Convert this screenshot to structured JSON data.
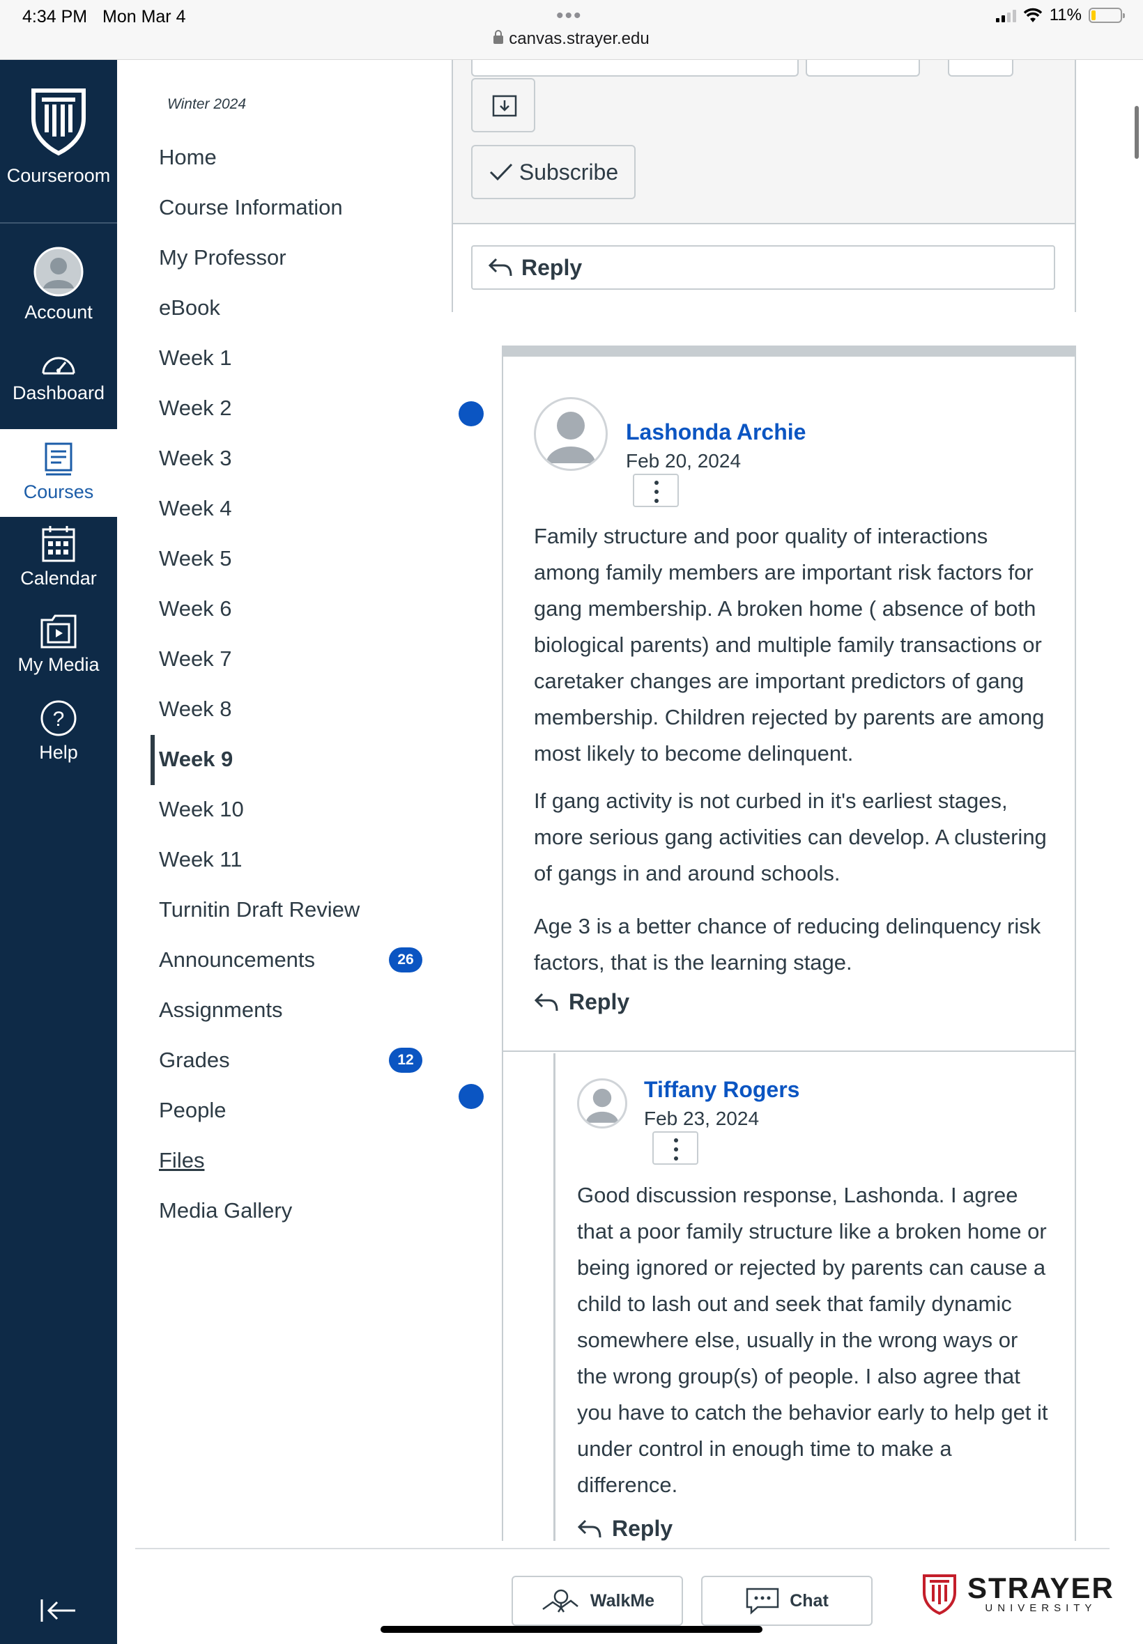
{
  "status_bar": {
    "time": "4:34 PM",
    "date": "Mon Mar 4",
    "url": "canvas.strayer.edu",
    "battery": "11%"
  },
  "global_nav": {
    "logo_label": "Courseroom",
    "items": [
      {
        "label": "Account",
        "icon": "account-icon"
      },
      {
        "label": "Dashboard",
        "icon": "dashboard-icon"
      },
      {
        "label": "Courses",
        "icon": "courses-icon"
      },
      {
        "label": "Calendar",
        "icon": "calendar-icon"
      },
      {
        "label": "My Media",
        "icon": "my-media-icon"
      },
      {
        "label": "Help",
        "icon": "help-icon"
      }
    ],
    "active": "Courses"
  },
  "course_nav": {
    "term": "Winter 2024",
    "items": [
      {
        "label": "Home"
      },
      {
        "label": "Course Information"
      },
      {
        "label": "My Professor"
      },
      {
        "label": "eBook"
      },
      {
        "label": "Week 1"
      },
      {
        "label": "Week 2"
      },
      {
        "label": "Week 3"
      },
      {
        "label": "Week 4"
      },
      {
        "label": "Week 5"
      },
      {
        "label": "Week 6"
      },
      {
        "label": "Week 7"
      },
      {
        "label": "Week 8"
      },
      {
        "label": "Week 9"
      },
      {
        "label": "Week 10"
      },
      {
        "label": "Week 11"
      },
      {
        "label": "Turnitin Draft Review"
      },
      {
        "label": "Announcements",
        "badge": "26"
      },
      {
        "label": "Assignments"
      },
      {
        "label": "Grades",
        "badge": "12"
      },
      {
        "label": "People"
      },
      {
        "label": "Files"
      },
      {
        "label": "Media Gallery"
      }
    ],
    "active": "Week 9"
  },
  "toolbar": {
    "subscribe_label": "Subscribe",
    "reply_label": "Reply"
  },
  "entries": [
    {
      "author": "Lashonda Archie",
      "date": "Feb 20, 2024",
      "paragraphs": [
        "Family structure and poor quality of interactions among family members are important risk factors for gang membership. A broken home ( absence of both biological parents) and multiple family transactions or caretaker changes are important predictors of gang membership. Children rejected by parents are among most likely to become delinquent.",
        "If gang activity is not curbed in it's earliest stages, more serious gang activities can develop. A clustering of gangs in and around schools.",
        "Age 3 is a better chance of reducing delinquency risk factors, that is the learning stage."
      ],
      "reply_label": "Reply"
    },
    {
      "author": "Tiffany Rogers",
      "date": "Feb 23, 2024",
      "paragraphs": [
        "Good discussion response, Lashonda. I agree that a poor family structure like a broken home or being ignored or rejected by parents can cause a child to lash out and seek that family dynamic somewhere else, usually in the wrong ways or the wrong group(s) of people. I also agree that you have to catch the behavior early to help get it under control in enough time to make a difference."
      ],
      "reply_label": "Reply"
    }
  ],
  "footer": {
    "walkme_label": "WalkMe",
    "chat_label": "Chat",
    "brand_name": "STRAYER",
    "brand_sub": "UNIVERSITY"
  },
  "colors": {
    "nav_bg": "#0e2a47",
    "link_blue": "#0b55c2",
    "text": "#2d3b45",
    "border": "#c7cdd1"
  }
}
